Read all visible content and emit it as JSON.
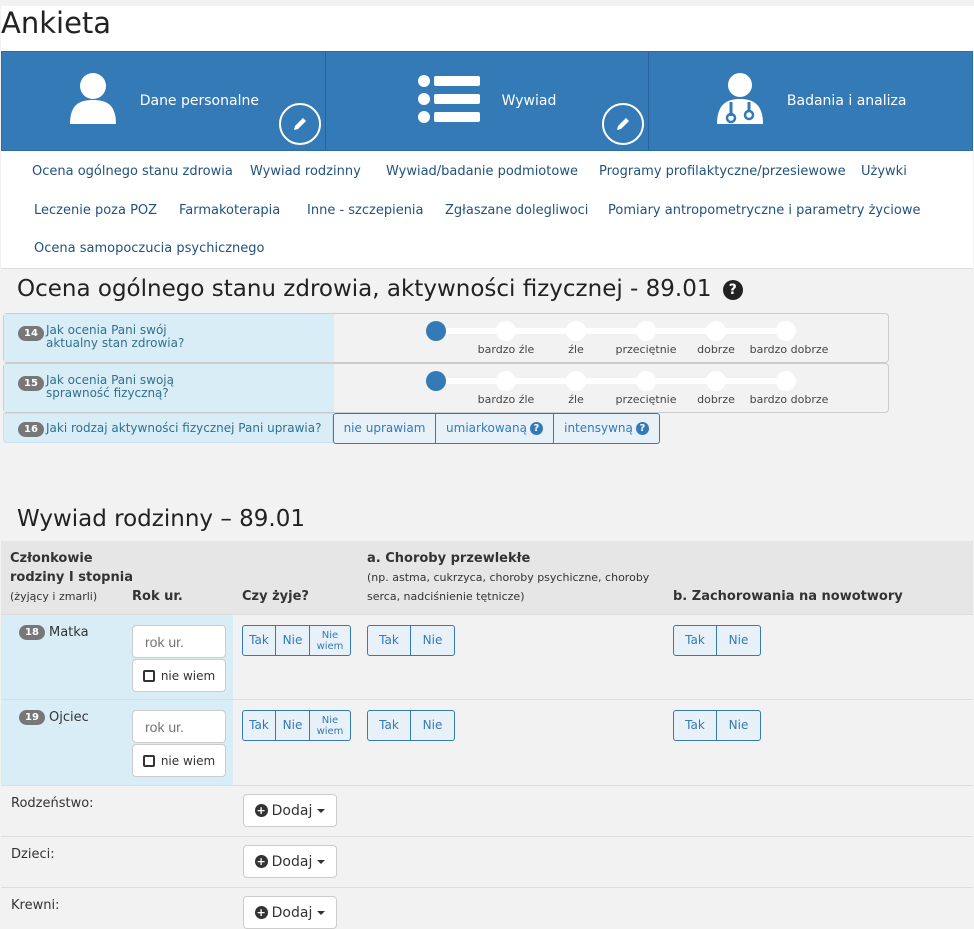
{
  "page_title": "Ankieta",
  "top_cards": [
    {
      "label": "Dane personalne",
      "icon": "person-icon"
    },
    {
      "label": "Wywiad",
      "icon": "list-icon"
    },
    {
      "label": "Badania i analiza",
      "icon": "doctor-icon"
    }
  ],
  "nav": [
    "Ocena ogólnego stanu zdrowia",
    "Wywiad rodzinny",
    "Wywiad/badanie podmiotowe",
    "Programy profilaktyczne/przesiewowe",
    "Używki",
    "Leczenie poza POZ",
    "Farmakoterapia",
    "Inne - szczepienia",
    "Zgłaszane dolegliwoci",
    "Pomiary antropometryczne i parametry życiowe",
    "Ocena samopoczucia psychicznego"
  ],
  "section1": {
    "title": "Ocena ogólnego stanu zdrowia, aktywności fizycznej - 89.01",
    "q14": {
      "num": "14",
      "line1": "Jak ocenia Pani swój",
      "line2": "aktualny stan zdrowia?"
    },
    "q15": {
      "num": "15",
      "line1": "Jak ocenia Pani swoją",
      "line2": "sprawność fizyczną?"
    },
    "scale": [
      "bardzo źle",
      "źle",
      "przeciętnie",
      "dobrze",
      "bardzo dobrze"
    ],
    "q16": {
      "num": "16",
      "text": "Jaki rodzaj aktywności fizycznej Pani uprawia?"
    },
    "q16_options": [
      "nie uprawiam",
      "umiarkowaną",
      "intensywną"
    ]
  },
  "section2": {
    "title": "Wywiad rodzinny – 89.01",
    "headers": {
      "members_line1": "Członkowie",
      "members_line2": "rodziny I stopnia",
      "members_line3": "(żyjący i zmarli)",
      "rok": "Rok ur.",
      "zyje": "Czy żyje?",
      "choroby": "a. Choroby przewlekłe",
      "choroby_sub1": "(np. astma, cukrzyca, choroby psychiczne, choroby",
      "choroby_sub2": "serca, nadciśnienie tętnicze)",
      "nowotwory": "b. Zachorowania na nowotwory"
    },
    "members": [
      {
        "num": "18",
        "name": "Matka"
      },
      {
        "num": "19",
        "name": "Ojciec"
      }
    ],
    "rok_placeholder": "rok ur.",
    "nie_wiem": "nie wiem",
    "tak": "Tak",
    "nie": "Nie",
    "nie_wiem_split1": "Nie",
    "nie_wiem_split2": "wiem",
    "extra_rows": [
      "Rodzeństwo:",
      "Dzieci:",
      "Krewni:"
    ],
    "dodaj": "Dodaj"
  }
}
